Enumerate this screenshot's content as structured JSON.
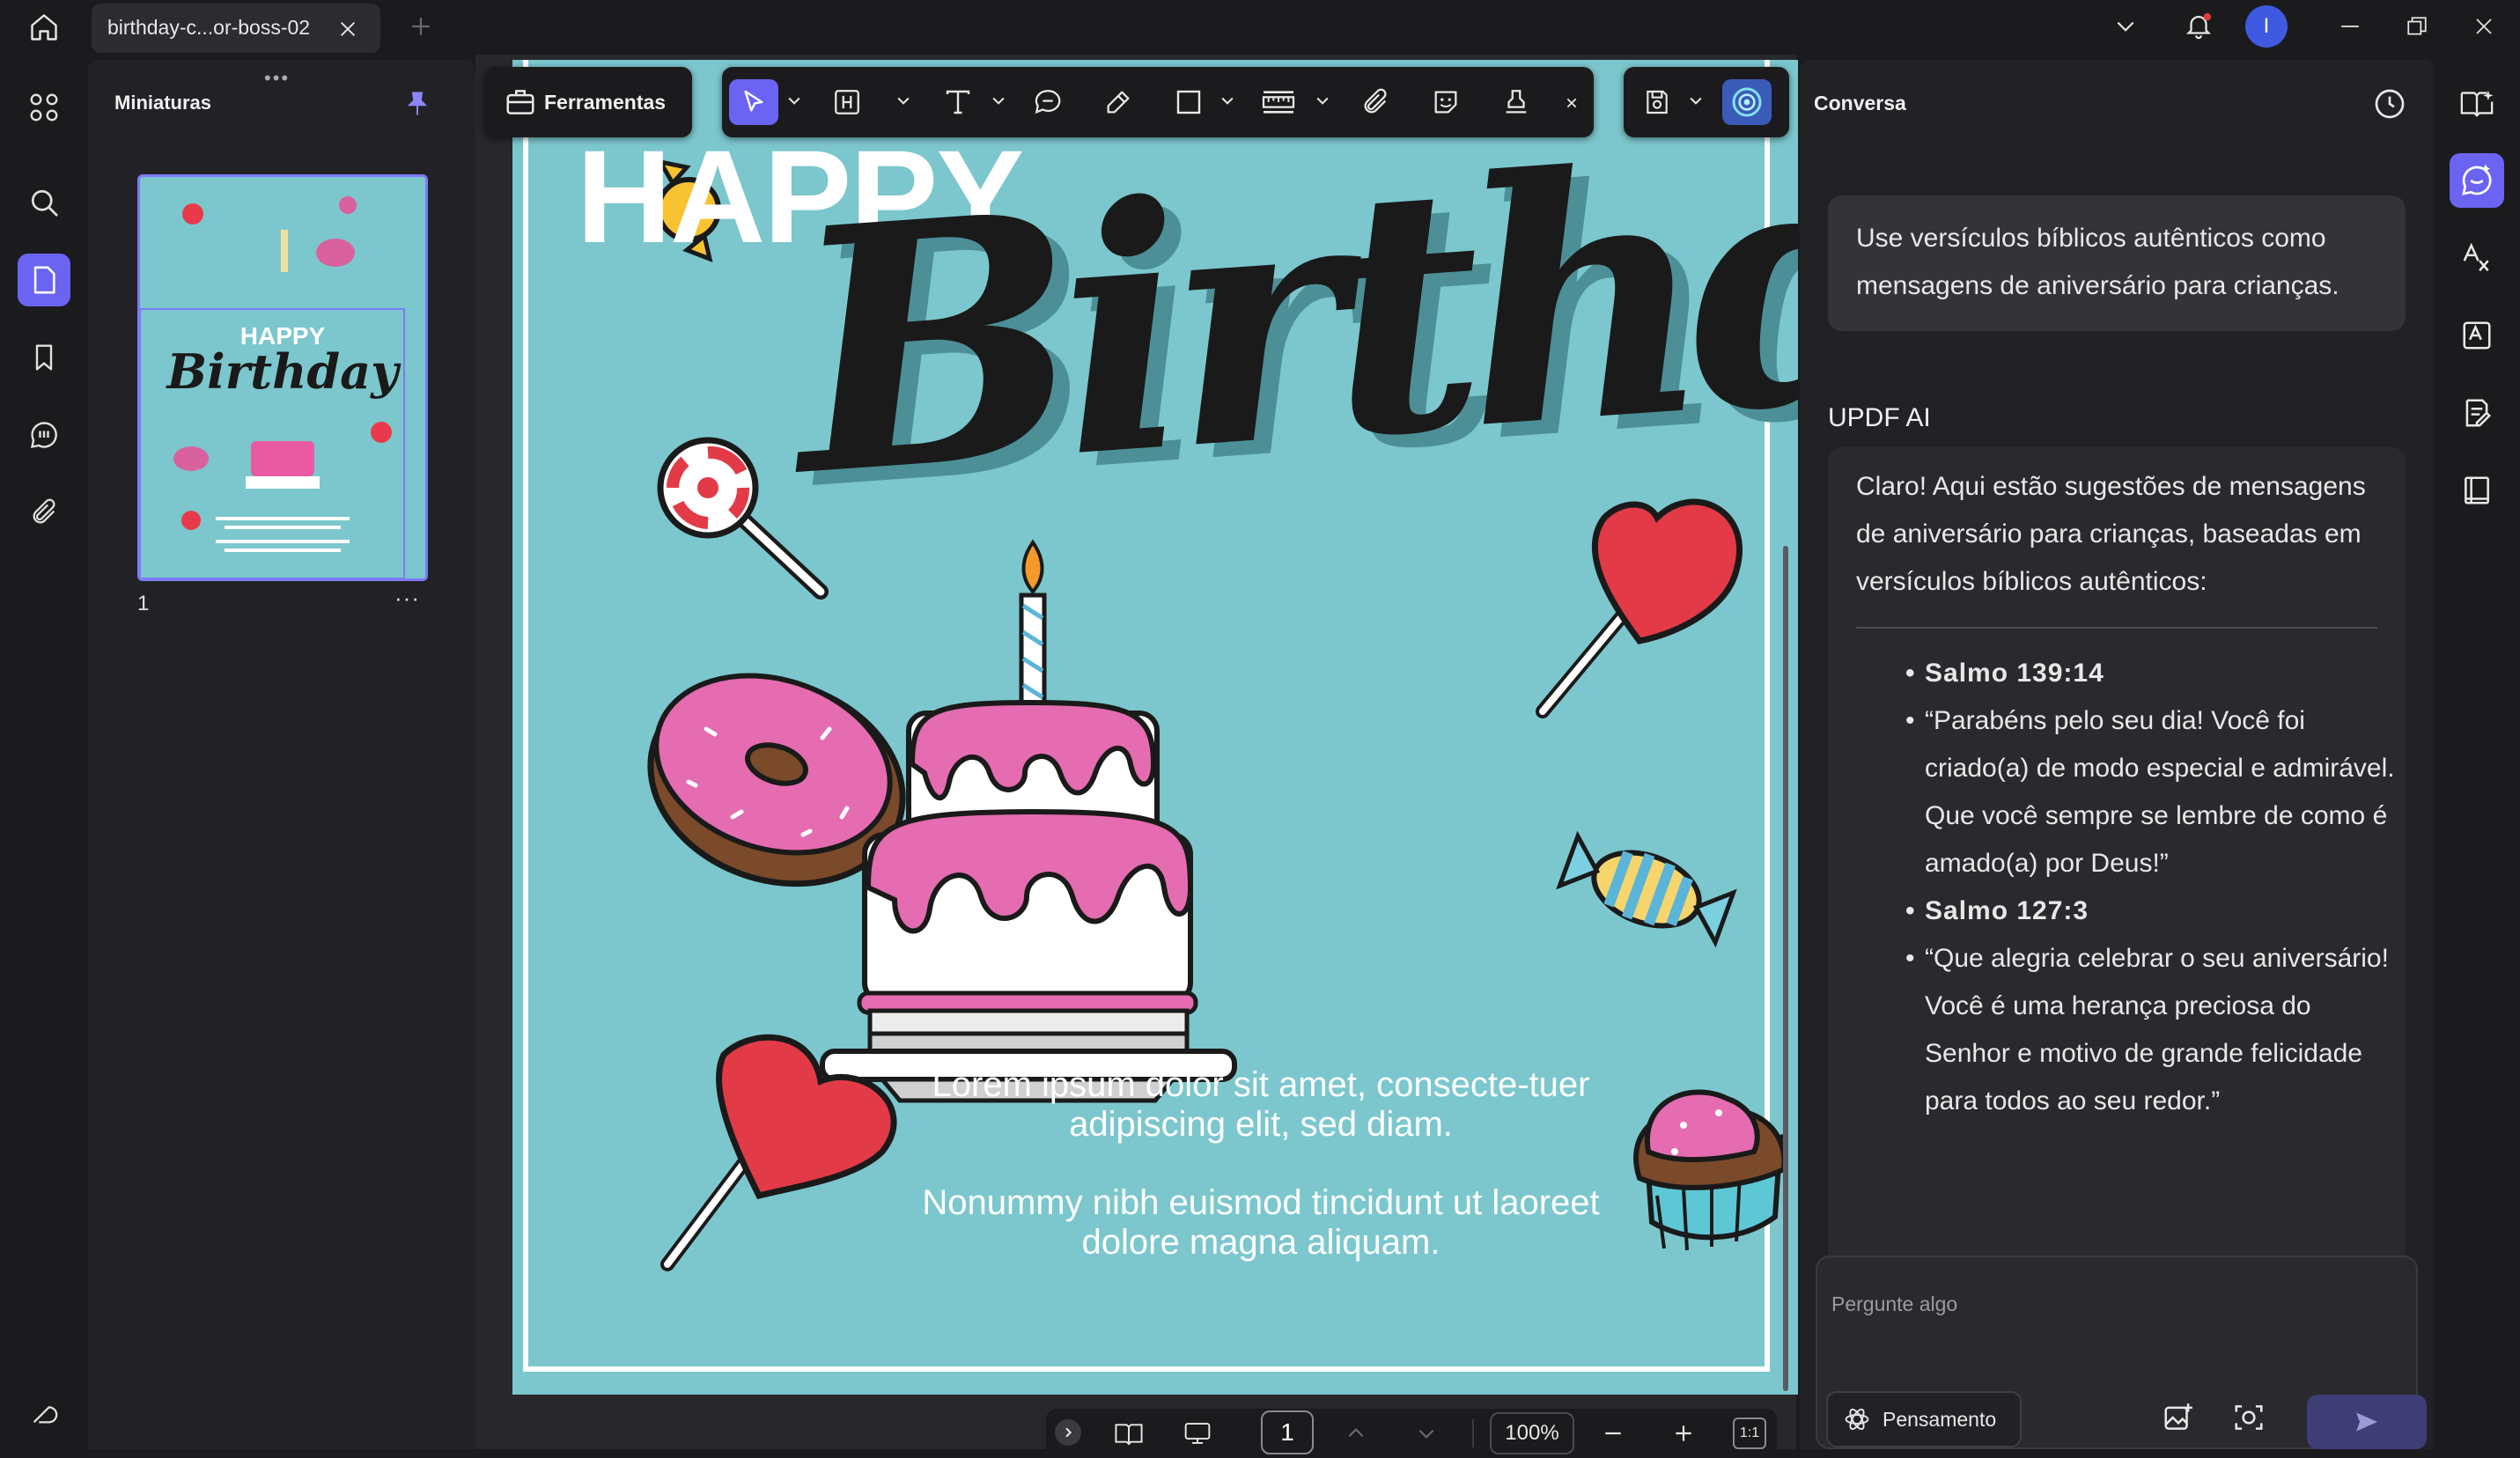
{
  "tab": {
    "title": "birthday-c...or-boss-02"
  },
  "user": {
    "avatar_letter": "I"
  },
  "thumbnails": {
    "title": "Miniaturas",
    "handle": "•••",
    "page_number": "1",
    "more": "···"
  },
  "toolbar": {
    "tools_label": "Ferramentas",
    "icons": [
      "select-icon",
      "text-box-icon",
      "text-icon",
      "comment-icon",
      "pen-icon",
      "shape-icon",
      "ruler-icon",
      "attach-icon",
      "sticker-icon",
      "stamp-icon",
      "save-icon",
      "ai-assistant-icon"
    ]
  },
  "document": {
    "heading_1": "HAPPY",
    "heading_2": "Birthday",
    "paragraph_1": "Lorem ipsum dolor sit amet, consecte-tuer adipiscing elit, sed diam.",
    "paragraph_2": "Nonummy nibh euismod tincidunt ut laoreet dolore magna aliquam."
  },
  "page_nav": {
    "current_page": "1",
    "zoom": "100%",
    "fit": "1:1"
  },
  "chat": {
    "title": "Conversa",
    "user_message": "Use versículos bíblicos autênticos como mensagens de aniversário para crianças.",
    "assistant_name": "UPDF AI",
    "assistant_intro": "Claro! Aqui estão sugestões de mensagens de aniversário para crianças, baseadas em versículos bíblicos autênticos:",
    "items": [
      {
        "text": "Salmo 139:14",
        "ref": true
      },
      {
        "text": "“Parabéns pelo seu dia! Você foi criado(a) de modo especial e admirável. Que você sempre se lembre de como é amado(a) por Deus!”",
        "ref": false
      },
      {
        "text": "Salmo 127:3",
        "ref": true
      },
      {
        "text": "“Que alegria celebrar o seu aniversário! Você é uma herança preciosa do Senhor e motivo de grande felicidade para todos ao seu redor.”",
        "ref": false
      }
    ],
    "input_placeholder": "Pergunte algo",
    "thinking_label": "Pensamento"
  },
  "colors": {
    "accent": "#6b64f2",
    "page_background": "#7bc7cd",
    "panel": "#222226",
    "app_background": "#1b1b1e"
  }
}
